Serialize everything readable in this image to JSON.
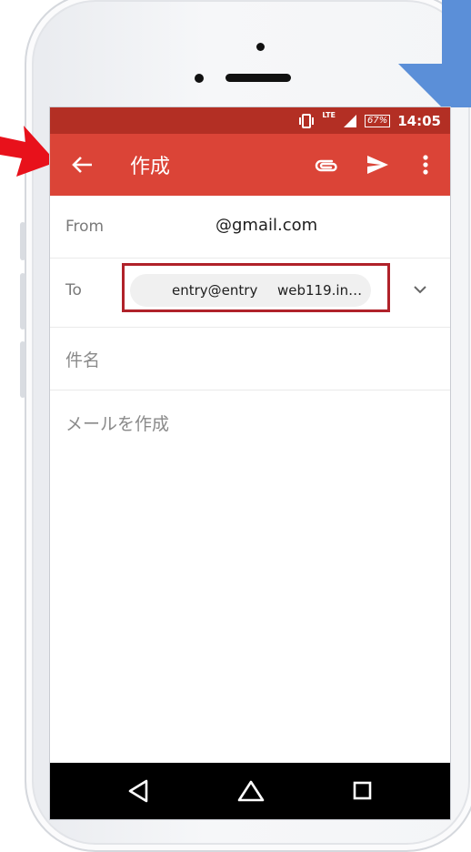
{
  "status_bar": {
    "signal_tag": "LTE",
    "battery": "67%",
    "time": "14:05"
  },
  "toolbar": {
    "title": "作成",
    "icons": [
      "back-arrow-icon",
      "attach-icon",
      "send-icon",
      "more-icon"
    ]
  },
  "compose": {
    "from_label": "From",
    "from_value": "@gmail.com",
    "to_label": "To",
    "to_chip_part1": "entry@entry",
    "to_chip_part2": "web119.in…",
    "subject_placeholder": "件名",
    "body_placeholder": "メールを作成"
  },
  "nav_bar": {
    "icons": [
      "back-triangle-icon",
      "home-icon",
      "recents-square-icon"
    ]
  },
  "colors": {
    "status_bar": "#b32f24",
    "toolbar": "#db4437",
    "highlight": "#b0222a",
    "callout": "#5b8fd8",
    "arrow": "#e8111b"
  }
}
